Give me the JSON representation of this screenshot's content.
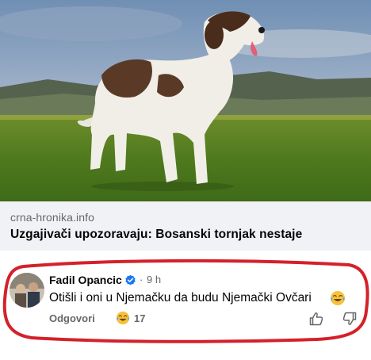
{
  "link_preview": {
    "image_description_icon": "dog-photo",
    "domain": "crna-hronika.info",
    "title": "Uzgajivači upozoravaju: Bosanski tornjak nestaje"
  },
  "comment": {
    "author": "Fadil Opancic",
    "verified_icon": "verified-badge-icon",
    "separator": "·",
    "time": "9 h",
    "text": "Otišli i oni u Njemačku da budu Njemački Ovčari",
    "text_emoji_icon": "laughing-tears-emoji",
    "reply_label": "Odgovori",
    "reaction_icon": "laughing-tears-emoji",
    "reaction_count": "17",
    "like_icon": "thumbs-up-icon",
    "dislike_icon": "thumbs-down-icon"
  },
  "colors": {
    "highlight_ellipse": "#d4212a",
    "verified": "#1877f2",
    "muted_text": "#65676b",
    "card_meta_bg": "#f0f2f5"
  }
}
